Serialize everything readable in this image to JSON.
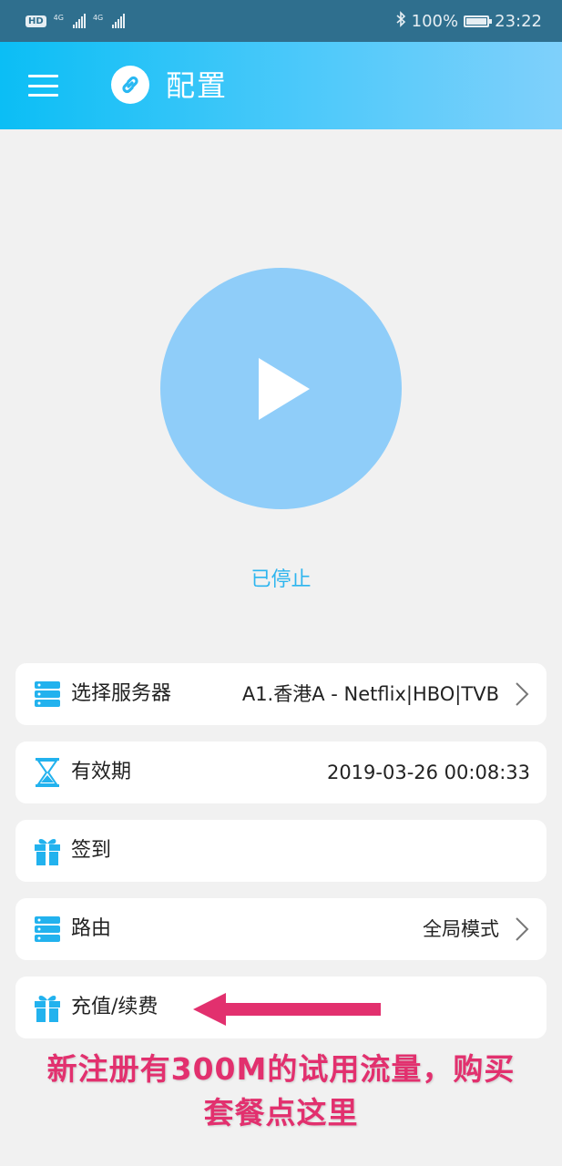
{
  "status_bar": {
    "hd": "HD",
    "net1": "4G",
    "net2": "4G",
    "battery": "100%",
    "time": "23:22"
  },
  "app_bar": {
    "title": "配置",
    "menu_icon": "menu-icon",
    "link_icon": "link-icon"
  },
  "main": {
    "status": "已停止",
    "play_icon": "play-icon"
  },
  "rows": [
    {
      "icon": "server-icon",
      "label": "选择服务器",
      "value": "A1.香港A - Netflix|HBO|TVB",
      "arrow": true
    },
    {
      "icon": "hourglass-icon",
      "label": "有效期",
      "value": "2019-03-26 00:08:33",
      "arrow": false
    },
    {
      "icon": "gift-icon",
      "label": "签到",
      "value": "",
      "arrow": false
    },
    {
      "icon": "server-icon",
      "label": "路由",
      "value": "全局模式",
      "arrow": true
    },
    {
      "icon": "gift-icon",
      "label": "充值/续费",
      "value": "",
      "arrow": false
    }
  ],
  "annotation": {
    "line1": "新注册有300M的试用流量，购买",
    "line2": "套餐点这里"
  },
  "colors": {
    "accent": "#0bbef5",
    "play": "#8fcdf9",
    "status_text": "#2db5ef",
    "annotation": "#e2306e"
  }
}
